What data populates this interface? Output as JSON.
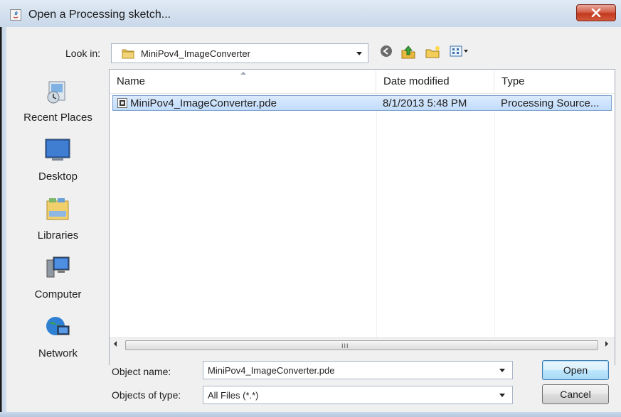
{
  "window": {
    "title": "Open a Processing sketch...",
    "close_icon": "close-icon"
  },
  "look_in": {
    "label": "Look in:",
    "value": "MiniPov4_ImageConverter"
  },
  "toolbar": {
    "icons": [
      "back-icon",
      "up-folder-icon",
      "new-folder-icon",
      "view-menu-icon"
    ]
  },
  "places": [
    {
      "label": "Recent Places",
      "icon": "recent-places-icon"
    },
    {
      "label": "Desktop",
      "icon": "desktop-icon"
    },
    {
      "label": "Libraries",
      "icon": "libraries-icon"
    },
    {
      "label": "Computer",
      "icon": "computer-icon"
    },
    {
      "label": "Network",
      "icon": "network-icon"
    }
  ],
  "file_list": {
    "columns": [
      "Name",
      "Date modified",
      "Type"
    ],
    "rows": [
      {
        "name": "MiniPov4_ImageConverter.pde",
        "date": "8/1/2013 5:48 PM",
        "type": "Processing Source..."
      }
    ],
    "scroll_grip": "III"
  },
  "object_name": {
    "label": "Object name:",
    "value": "MiniPov4_ImageConverter.pde"
  },
  "object_type": {
    "label": "Objects of type:",
    "value": "All Files (*.*)"
  },
  "buttons": {
    "open": "Open",
    "cancel": "Cancel"
  },
  "colors": {
    "selection": "#c1dcfc",
    "close_button": "#c2391f",
    "titlebar": "#d5e1ef"
  }
}
